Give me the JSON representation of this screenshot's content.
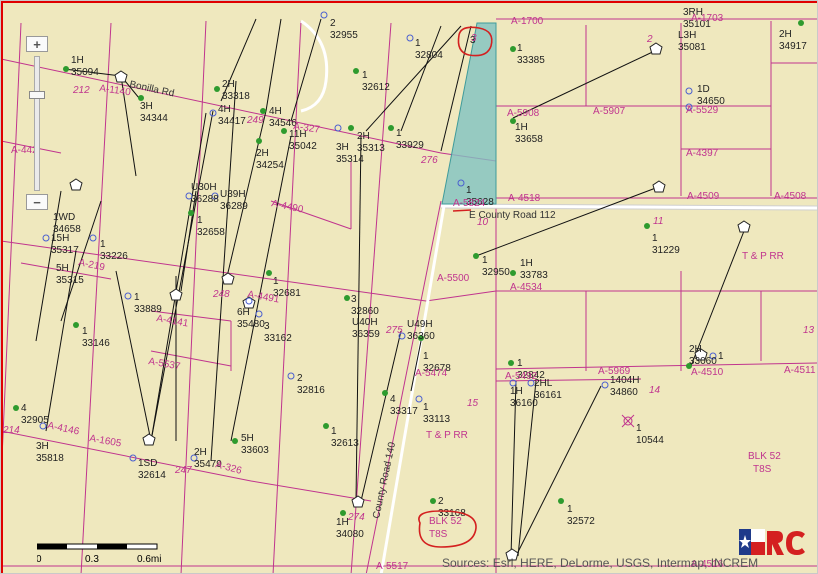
{
  "attribution": "Sources: Esri, HERE, DeLorme, USGS, Intermap, INCREM",
  "scale": {
    "zero": "0",
    "mid": "0.3",
    "end": "0.6mi"
  },
  "zoom": {
    "in": "+",
    "out": "−"
  },
  "roads": {
    "county_road_112": "E County Road 112",
    "county_road_140": "County Road 140",
    "bonilla_rd": "Bonilla Rd"
  },
  "block_labels": {
    "blk52_right": "BLK 52",
    "t8s_right": "T8S",
    "blk52_circled": "BLK 52",
    "t8s_circled": "T8S",
    "tprr_center": "T & P RR",
    "tprr_right": "T & P RR"
  },
  "sections": [
    "212",
    "249",
    "276",
    "10",
    "11",
    "2",
    "3",
    "15",
    "14",
    "13",
    "248",
    "275",
    "247",
    "274",
    "214"
  ],
  "abstracts": [
    "A-1700",
    "A-1703",
    "A-5908",
    "A-5907",
    "A-5529",
    "A-4397",
    "A-4518",
    "A-4509",
    "A-4508",
    "A-5824",
    "A-5500",
    "A-4534",
    "A-5969",
    "A-4510",
    "A-4511",
    "A-5474",
    "A-5492",
    "A-4490",
    "A-4491",
    "A-4141",
    "A-5537",
    "A-1605",
    "A-4146",
    "A-326",
    "A-327",
    "A-1140",
    "A-442",
    "A-219",
    "A-5517",
    "A-4516"
  ],
  "wells": [
    {
      "t": "1H",
      "n": "35094"
    },
    {
      "t": "3H",
      "n": "34344"
    },
    {
      "t": "2H",
      "n": "33318"
    },
    {
      "t": "4H",
      "n": "34417"
    },
    {
      "t": "4H",
      "n": "34546"
    },
    {
      "t": "1",
      "n": "32612"
    },
    {
      "t": "2",
      "n": "32955"
    },
    {
      "t": "1",
      "n": "32804"
    },
    {
      "t": "3",
      "n": ""
    },
    {
      "t": "1",
      "n": "33385"
    },
    {
      "t": "11H",
      "n": "35042"
    },
    {
      "t": "2H",
      "n": "34254"
    },
    {
      "t": "3H",
      "n": "35314"
    },
    {
      "t": "2H",
      "n": "35313"
    },
    {
      "t": "1",
      "n": "33929"
    },
    {
      "t": "1H",
      "n": "33658"
    },
    {
      "t": "1",
      "n": "35628"
    },
    {
      "t": "1D",
      "n": "34650"
    },
    {
      "t": "3RH",
      "n": "35101"
    },
    {
      "t": "L3H",
      "n": "35081"
    },
    {
      "t": "2H",
      "n": "34917"
    },
    {
      "t": "U30H",
      "n": "36288"
    },
    {
      "t": "U39H",
      "n": "36289"
    },
    {
      "t": "1",
      "n": "32658"
    },
    {
      "t": "1WD",
      "n": "34658"
    },
    {
      "t": "15H",
      "n": "35317"
    },
    {
      "t": "1",
      "n": "33226"
    },
    {
      "t": "5H",
      "n": "35315"
    },
    {
      "t": "1",
      "n": "32681"
    },
    {
      "t": "1",
      "n": "32950"
    },
    {
      "t": "1H",
      "n": "33783"
    },
    {
      "t": "1",
      "n": "31229"
    },
    {
      "t": "1",
      "n": "33889"
    },
    {
      "t": "3",
      "n": "32860"
    },
    {
      "t": "U40H",
      "n": "36359"
    },
    {
      "t": "U49H",
      "n": "36360"
    },
    {
      "t": "6H",
      "n": "35480"
    },
    {
      "t": "3",
      "n": "33162"
    },
    {
      "t": "1",
      "n": "33146"
    },
    {
      "t": "1",
      "n": "32678"
    },
    {
      "t": "1",
      "n": "32842"
    },
    {
      "t": "2H",
      "n": "33060"
    },
    {
      "t": "1",
      "n": ""
    },
    {
      "t": "2",
      "n": "32816"
    },
    {
      "t": "4",
      "n": "33317"
    },
    {
      "t": "1",
      "n": "33113"
    },
    {
      "t": "1H",
      "n": "36160"
    },
    {
      "t": "2HL",
      "n": "36161"
    },
    {
      "t": "1404H",
      "n": "34860"
    },
    {
      "t": "1",
      "n": "10544"
    },
    {
      "t": "4",
      "n": "32905"
    },
    {
      "t": "3H",
      "n": "35818"
    },
    {
      "t": "1",
      "n": "32613"
    },
    {
      "t": "5H",
      "n": "33603"
    },
    {
      "t": "2H",
      "n": "35479"
    },
    {
      "t": "1SD",
      "n": "32614"
    },
    {
      "t": "2",
      "n": "33168"
    },
    {
      "t": "1",
      "n": "32572"
    },
    {
      "t": "1H",
      "n": "34080"
    }
  ],
  "colors": {
    "map_bg": "#efe8be",
    "survey_line": "#c0348e",
    "well_green": "#2e9b2e",
    "well_blue": "#4a5fd0",
    "highlight_fill": "#7fc2c2",
    "annotation_red": "#d42020",
    "frame_red": "#e00000"
  }
}
